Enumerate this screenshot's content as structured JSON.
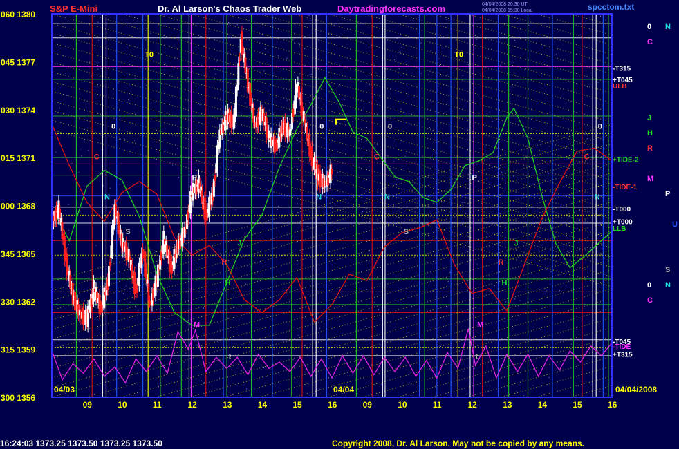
{
  "header": {
    "instrument": "S&P E-Mini",
    "title": "Dr. Al Larson's Chaos Trader Web",
    "site": "Daytradingforecasts.com",
    "file": "spcctom.txt",
    "stamp_line1": "04/04/2008 20:30 UT",
    "stamp_line2": "04/04/2008 15:30 Local"
  },
  "footer": {
    "quote": "16:24:03  1373.25  1373.50  1373.25  1373.50",
    "copyright": "Copyright 2008, Dr. Al Larson. May not be copied by any means."
  },
  "colors": {
    "background": "#00004a",
    "plot_border": "#3030ff",
    "price_up": "#ffffff",
    "price_down": "#ff2020",
    "green_line": "#22cc22",
    "red_line": "#dd1111",
    "magenta_line": "#dd22dd",
    "yellow_grid": "#e6e600",
    "title_red": "#ff3030",
    "site_magenta": "#ff33ff"
  },
  "chart_data": {
    "type": "candlestick",
    "y_axis": {
      "labels": [
        "060 1380",
        "045 1377",
        "030 1374",
        "015 1371",
        "000 1368",
        "345 1365",
        "330 1362",
        "315 1359",
        "300 1356"
      ],
      "ylim": [
        1356,
        1380
      ]
    },
    "x_axis": {
      "labels": [
        "09",
        "10",
        "11",
        "12",
        "13",
        "14",
        "15",
        "16",
        "09",
        "10",
        "11",
        "12",
        "13",
        "14",
        "15",
        "16"
      ],
      "date_start": "04/03",
      "date_mid": "04/04",
      "date_end": "04/04/2008",
      "xlim": [
        0,
        16
      ]
    },
    "level_labels": [
      {
        "text": "-T315",
        "price": 1376.6,
        "color": "#ffffff"
      },
      {
        "text": "+T045",
        "price": 1375.9,
        "color": "#ffffff"
      },
      {
        "text": "ULB",
        "price": 1375.5,
        "color": "#ff3030"
      },
      {
        "text": "+TIDE-2",
        "price": 1370.9,
        "color": "#22dd22"
      },
      {
        "text": "-TIDE-1",
        "price": 1369.2,
        "color": "#ff3030"
      },
      {
        "text": "-T000",
        "price": 1367.8,
        "color": "#ffffff"
      },
      {
        "text": "+T000",
        "price": 1367.0,
        "color": "#ffffff"
      },
      {
        "text": "LLB",
        "price": 1366.6,
        "color": "#22dd22"
      },
      {
        "text": "-T045",
        "price": 1359.5,
        "color": "#ffffff"
      },
      {
        "text": "-TIDE",
        "price": 1359.2,
        "color": "#ff33ff"
      },
      {
        "text": "+T315",
        "price": 1358.7,
        "color": "#ffffff"
      }
    ],
    "planet_letters": [
      {
        "text": "0",
        "col": 0,
        "row": 0,
        "color": "#ffffff"
      },
      {
        "text": "N",
        "col": 1,
        "row": 0,
        "color": "#22dddd"
      },
      {
        "text": "C",
        "col": 0,
        "row": 1,
        "color": "#ff33ff"
      },
      {
        "text": "J",
        "col": 0,
        "row": 6,
        "color": "#22dd22"
      },
      {
        "text": "H",
        "col": 0,
        "row": 7,
        "color": "#22dd22"
      },
      {
        "text": "R",
        "col": 0,
        "row": 8,
        "color": "#ff3030"
      },
      {
        "text": "M",
        "col": 0,
        "row": 10,
        "color": "#ff33ff"
      },
      {
        "text": "P",
        "col": 1,
        "row": 11,
        "color": "#ffffff"
      },
      {
        "text": "U",
        "col": 2,
        "row": 13,
        "color": "#2255ff"
      },
      {
        "text": "S",
        "col": 1,
        "row": 16,
        "color": "#aaaaaa"
      },
      {
        "text": "0",
        "col": 0,
        "row": 17,
        "color": "#ffffff"
      },
      {
        "text": "N",
        "col": 1,
        "row": 17,
        "color": "#22dddd"
      },
      {
        "text": "C",
        "col": 0,
        "row": 18,
        "color": "#ff33ff"
      }
    ],
    "chart_markers": [
      {
        "text": "T0",
        "x": 2.65,
        "price": 1377.3,
        "color": "#ffff00"
      },
      {
        "text": "T0",
        "x": 11.5,
        "price": 1377.3,
        "color": "#ffff00"
      },
      {
        "text": "0",
        "x": 1.7,
        "price": 1372.8,
        "color": "#ffffff"
      },
      {
        "text": "0",
        "x": 7.65,
        "price": 1372.8,
        "color": "#ffffff"
      },
      {
        "text": "0",
        "x": 9.6,
        "price": 1372.8,
        "color": "#ffffff"
      },
      {
        "text": "0",
        "x": 15.6,
        "price": 1372.8,
        "color": "#ffffff"
      },
      {
        "text": "C",
        "x": 1.2,
        "price": 1370.9,
        "color": "#ff3030"
      },
      {
        "text": "C",
        "x": 9.2,
        "price": 1370.9,
        "color": "#ff3030"
      },
      {
        "text": "C",
        "x": 15.2,
        "price": 1370.9,
        "color": "#ff3030"
      },
      {
        "text": "N",
        "x": 1.5,
        "price": 1368.4,
        "color": "#22dddd"
      },
      {
        "text": "N",
        "x": 7.55,
        "price": 1368.4,
        "color": "#22dddd"
      },
      {
        "text": "N",
        "x": 9.5,
        "price": 1368.4,
        "color": "#22dddd"
      },
      {
        "text": "N",
        "x": 15.5,
        "price": 1368.4,
        "color": "#22dddd"
      },
      {
        "text": "P",
        "x": 4.0,
        "price": 1369.6,
        "color": "#ffffff"
      },
      {
        "text": "P",
        "x": 12.0,
        "price": 1369.6,
        "color": "#ffffff"
      },
      {
        "text": "S",
        "x": 2.1,
        "price": 1366.2,
        "color": "#aaaaaa"
      },
      {
        "text": "S",
        "x": 10.05,
        "price": 1366.2,
        "color": "#aaaaaa"
      },
      {
        "text": "J",
        "x": 5.3,
        "price": 1365.5,
        "color": "#22dd22"
      },
      {
        "text": "J",
        "x": 13.2,
        "price": 1365.5,
        "color": "#22dd22"
      },
      {
        "text": "R",
        "x": 4.85,
        "price": 1364.3,
        "color": "#ff3030"
      },
      {
        "text": "R",
        "x": 12.75,
        "price": 1364.3,
        "color": "#ff3030"
      },
      {
        "text": "H",
        "x": 4.95,
        "price": 1363.0,
        "color": "#22dd22"
      },
      {
        "text": "H",
        "x": 12.85,
        "price": 1363.0,
        "color": "#22dd22"
      },
      {
        "text": "M",
        "x": 4.05,
        "price": 1360.4,
        "color": "#ff33ff"
      },
      {
        "text": "M",
        "x": 12.15,
        "price": 1360.4,
        "color": "#ff33ff"
      },
      {
        "text": "t",
        "x": 5.05,
        "price": 1358.4,
        "color": "#aaaaaa"
      },
      {
        "text": "t",
        "x": 12.1,
        "price": 1358.4,
        "color": "#aaaaaa"
      }
    ],
    "vertical_lines": [
      {
        "x": 0.7,
        "color": "#22cc22"
      },
      {
        "x": 1.15,
        "color": "#dd1111"
      },
      {
        "x": 1.45,
        "color": "#ffffff"
      },
      {
        "x": 1.55,
        "color": "#ffffff"
      },
      {
        "x": 1.85,
        "color": "#2255ff"
      },
      {
        "x": 2.6,
        "color": "#2255ff"
      },
      {
        "x": 2.75,
        "color": "#ffff00"
      },
      {
        "x": 3.1,
        "color": "#22cc22"
      },
      {
        "x": 3.7,
        "color": "#22cc22"
      },
      {
        "x": 3.92,
        "color": "#ffffff"
      },
      {
        "x": 3.98,
        "color": "#ff33ff"
      },
      {
        "x": 4.4,
        "color": "#dd1111"
      },
      {
        "x": 4.9,
        "color": "#2255ff"
      },
      {
        "x": 5.0,
        "color": "#22cc22"
      },
      {
        "x": 5.7,
        "color": "#22cc22"
      },
      {
        "x": 6.3,
        "color": "#2255ff"
      },
      {
        "x": 6.85,
        "color": "#22cc22"
      },
      {
        "x": 7.15,
        "color": "#dd1111"
      },
      {
        "x": 7.45,
        "color": "#ffffff"
      },
      {
        "x": 7.55,
        "color": "#ffffff"
      },
      {
        "x": 7.85,
        "color": "#2255ff"
      },
      {
        "x": 8.7,
        "color": "#22cc22"
      },
      {
        "x": 9.15,
        "color": "#dd1111"
      },
      {
        "x": 9.45,
        "color": "#ffffff"
      },
      {
        "x": 9.52,
        "color": "#ffffff"
      },
      {
        "x": 10.5,
        "color": "#2255ff"
      },
      {
        "x": 10.65,
        "color": "#22cc22"
      },
      {
        "x": 11.0,
        "color": "#2255ff"
      },
      {
        "x": 11.4,
        "color": "#2255ff"
      },
      {
        "x": 11.6,
        "color": "#ffff00"
      },
      {
        "x": 11.95,
        "color": "#ffffff"
      },
      {
        "x": 12.05,
        "color": "#ff33ff"
      },
      {
        "x": 12.3,
        "color": "#dd1111"
      },
      {
        "x": 12.75,
        "color": "#2255ff"
      },
      {
        "x": 13.05,
        "color": "#22cc22"
      },
      {
        "x": 13.6,
        "color": "#22cc22"
      },
      {
        "x": 14.3,
        "color": "#2255ff"
      },
      {
        "x": 14.9,
        "color": "#22cc22"
      },
      {
        "x": 15.15,
        "color": "#dd1111"
      },
      {
        "x": 15.45,
        "color": "#ffffff"
      },
      {
        "x": 15.55,
        "color": "#ffffff"
      },
      {
        "x": 15.75,
        "color": "#2255ff"
      },
      {
        "x": 15.9,
        "color": "#22cc22"
      }
    ],
    "horizontal_lines": [
      {
        "price": 1379.4,
        "color": "#ffffff"
      },
      {
        "price": 1378.5,
        "color": "#ffffff"
      },
      {
        "price": 1376.7,
        "color": "#ff33ff"
      },
      {
        "price": 1375.9,
        "color": "#22cc22"
      },
      {
        "price": 1373.6,
        "color": "#22cc22"
      },
      {
        "price": 1372.5,
        "color": "#e6e600"
      },
      {
        "price": 1371.0,
        "color": "#22cc22"
      },
      {
        "price": 1370.6,
        "color": "#dd1111"
      },
      {
        "price": 1369.9,
        "color": "#22cc22"
      },
      {
        "price": 1368.6,
        "color": "#2255ff"
      },
      {
        "price": 1367.9,
        "color": "#ffffff"
      },
      {
        "price": 1367.4,
        "color": "#e6e600"
      },
      {
        "price": 1366.9,
        "color": "#ffffff"
      },
      {
        "price": 1365.8,
        "color": "#dd1111"
      },
      {
        "price": 1364.9,
        "color": "#e6e600"
      },
      {
        "price": 1363.4,
        "color": "#22cc22"
      },
      {
        "price": 1362.6,
        "color": "#e6e600"
      },
      {
        "price": 1361.8,
        "color": "#22cc22"
      },
      {
        "price": 1361.3,
        "color": "#dd1111"
      },
      {
        "price": 1359.6,
        "color": "#ffffff"
      },
      {
        "price": 1359.1,
        "color": "#e6e600"
      },
      {
        "price": 1358.6,
        "color": "#ffffff"
      }
    ],
    "price_series": {
      "x": [
        0.0,
        0.2,
        0.4,
        0.6,
        0.8,
        1.0,
        1.2,
        1.4,
        1.6,
        1.8,
        2.0,
        2.2,
        2.4,
        2.6,
        2.8,
        3.0,
        3.2,
        3.4,
        3.6,
        3.8,
        4.0,
        4.2,
        4.4,
        4.6,
        4.8,
        5.0,
        5.2,
        5.4,
        5.6,
        5.8,
        6.0,
        6.2,
        6.4,
        6.6,
        6.8,
        7.0,
        7.2,
        7.4,
        7.6,
        7.8,
        8.0
      ],
      "price": [
        1367.0,
        1367.8,
        1364.5,
        1362.3,
        1361.2,
        1360.9,
        1362.8,
        1361.5,
        1363.2,
        1367.8,
        1365.6,
        1364.8,
        1362.6,
        1365.2,
        1361.7,
        1363.4,
        1365.9,
        1364.0,
        1365.5,
        1366.4,
        1368.8,
        1369.4,
        1367.3,
        1368.8,
        1372.5,
        1373.6,
        1373.2,
        1378.4,
        1375.6,
        1373.0,
        1373.8,
        1372.2,
        1371.7,
        1373.0,
        1372.5,
        1375.6,
        1373.4,
        1371.2,
        1369.8,
        1369.3,
        1370.2
      ]
    },
    "green_series": {
      "x": [
        0.0,
        0.5,
        1.0,
        1.5,
        2.0,
        2.5,
        3.0,
        3.5,
        4.0,
        4.5,
        5.0,
        5.5,
        6.0,
        6.5,
        7.0,
        7.4,
        7.8,
        8.2,
        8.6,
        9.0,
        9.4,
        9.8,
        10.2,
        10.6,
        11.0,
        11.4,
        11.8,
        12.2,
        12.6,
        13.0,
        13.2,
        13.6,
        14.0,
        14.4,
        14.8,
        15.2,
        15.6,
        16.0
      ],
      "price": [
        1367.8,
        1365.8,
        1369.2,
        1370.2,
        1369.6,
        1367.3,
        1363.7,
        1361.3,
        1360.5,
        1360.5,
        1363.2,
        1365.9,
        1367.4,
        1370.4,
        1372.8,
        1374.3,
        1376.0,
        1374.5,
        1372.6,
        1372.2,
        1371.0,
        1369.8,
        1369.5,
        1368.5,
        1368.2,
        1369.0,
        1370.5,
        1370.8,
        1371.3,
        1373.5,
        1374.1,
        1372.2,
        1368.6,
        1365.6,
        1364.1,
        1364.8,
        1365.6,
        1366.4
      ]
    },
    "red_series": {
      "x": [
        0.0,
        0.5,
        1.0,
        1.5,
        2.0,
        2.5,
        3.0,
        3.5,
        4.0,
        4.5,
        5.0,
        5.5,
        6.0,
        6.5,
        7.0,
        7.5,
        8.0,
        8.5,
        9.0,
        9.5,
        10.0,
        10.5,
        11.0,
        11.5,
        12.0,
        12.5,
        13.0,
        13.5,
        14.0,
        14.5,
        15.0,
        15.5,
        16.0
      ],
      "price": [
        1373.1,
        1370.5,
        1368.2,
        1367.0,
        1368.8,
        1369.5,
        1368.7,
        1366.0,
        1364.9,
        1365.5,
        1364.3,
        1362.1,
        1361.3,
        1362.1,
        1363.5,
        1360.7,
        1361.8,
        1363.7,
        1363.3,
        1365.4,
        1366.3,
        1366.6,
        1367.1,
        1364.3,
        1362.5,
        1362.8,
        1361.4,
        1364.3,
        1367.2,
        1369.4,
        1371.4,
        1371.6,
        1370.8
      ]
    },
    "magenta_series": {
      "x": [
        0.0,
        0.3,
        0.6,
        0.9,
        1.2,
        1.5,
        1.8,
        2.1,
        2.4,
        2.7,
        3.0,
        3.3,
        3.6,
        3.9,
        4.1,
        4.4,
        4.7,
        5.0,
        5.3,
        5.6,
        5.9,
        6.2,
        6.5,
        6.8,
        7.1,
        7.4,
        7.7,
        8.0,
        8.3,
        8.6,
        8.9,
        9.2,
        9.5,
        9.8,
        10.1,
        10.4,
        10.7,
        11.0,
        11.3,
        11.6,
        11.9,
        12.1,
        12.4,
        12.7,
        13.0,
        13.3,
        13.6,
        13.9,
        14.2,
        14.5,
        14.8,
        15.1,
        15.4,
        15.7,
        16.0
      ],
      "price": [
        1358.9,
        1357.1,
        1358.1,
        1357.5,
        1358.4,
        1357.3,
        1357.9,
        1356.9,
        1358.4,
        1357.6,
        1358.6,
        1357.5,
        1360.1,
        1359.0,
        1360.2,
        1357.6,
        1358.5,
        1357.8,
        1358.5,
        1357.4,
        1358.7,
        1357.8,
        1358.2,
        1357.6,
        1358.5,
        1357.3,
        1358.4,
        1357.2,
        1358.6,
        1357.5,
        1358.6,
        1357.4,
        1358.5,
        1357.6,
        1358.5,
        1357.3,
        1358.3,
        1357.2,
        1358.8,
        1357.8,
        1360.3,
        1358.0,
        1359.2,
        1357.2,
        1358.7,
        1357.6,
        1358.7,
        1357.3,
        1358.6,
        1357.7,
        1358.9,
        1358.2,
        1359.2,
        1358.6,
        1359.4
      ]
    }
  }
}
